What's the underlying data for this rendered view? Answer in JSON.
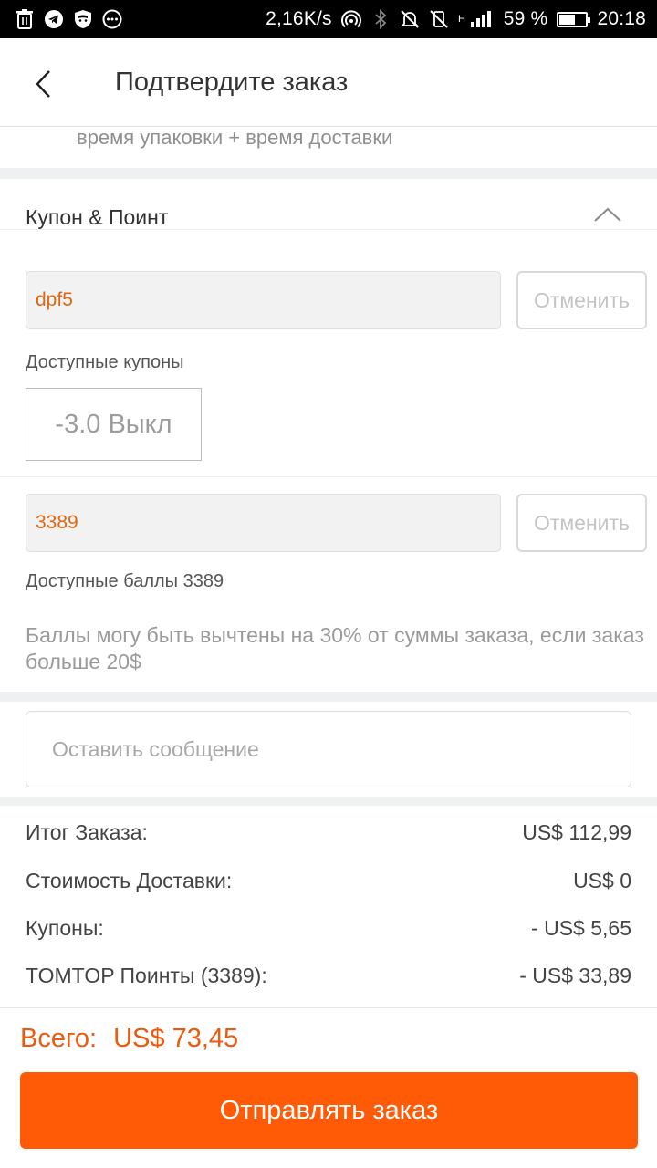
{
  "status_bar": {
    "speed": "2,16K/s",
    "network": "H",
    "battery_percent": "59 %",
    "battery_level": 0.59,
    "time": "20:18",
    "icons": [
      "trash-icon",
      "telegram-icon",
      "shield-icon",
      "more-icon",
      "hotspot-icon",
      "bluetooth-icon",
      "mute-icon",
      "vibrate-off-icon",
      "signal-icon",
      "battery-icon"
    ]
  },
  "header": {
    "title": "Подтвердите заказ"
  },
  "delivery": {
    "cut_text": "время упаковки + время доставки"
  },
  "coupon_section": {
    "title": "Купон & Поинт",
    "coupon_code": "dpf5",
    "cancel_label": "Отменить",
    "available_coupons_label": "Доступные купоны",
    "coupon_chip": "-3.0 Выкл",
    "points_value": "3389",
    "points_cancel_label": "Отменить",
    "available_points_label": "Доступные баллы 3389",
    "note": "Баллы могу быть вычтены на 30% от суммы заказа, если заказ больше 20$"
  },
  "message": {
    "placeholder": "Оставить сообщение"
  },
  "summary": {
    "rows": [
      {
        "label": "Итог Заказа:",
        "value": "US$ 112,99"
      },
      {
        "label": "Стоимость Доставки:",
        "value": "US$ 0"
      },
      {
        "label": "Купоны:",
        "value": "- US$ 5,65"
      },
      {
        "label": "TOMTOP Поинты (3389):",
        "value": "- US$ 33,89"
      }
    ]
  },
  "footer": {
    "total_label": "Всего:",
    "total_value": "US$ 73,45",
    "submit_label": "Отправлять заказ"
  },
  "colors": {
    "accent": "#ff5a05",
    "total_text": "#ec5a10",
    "input_text": "#e0670f"
  }
}
